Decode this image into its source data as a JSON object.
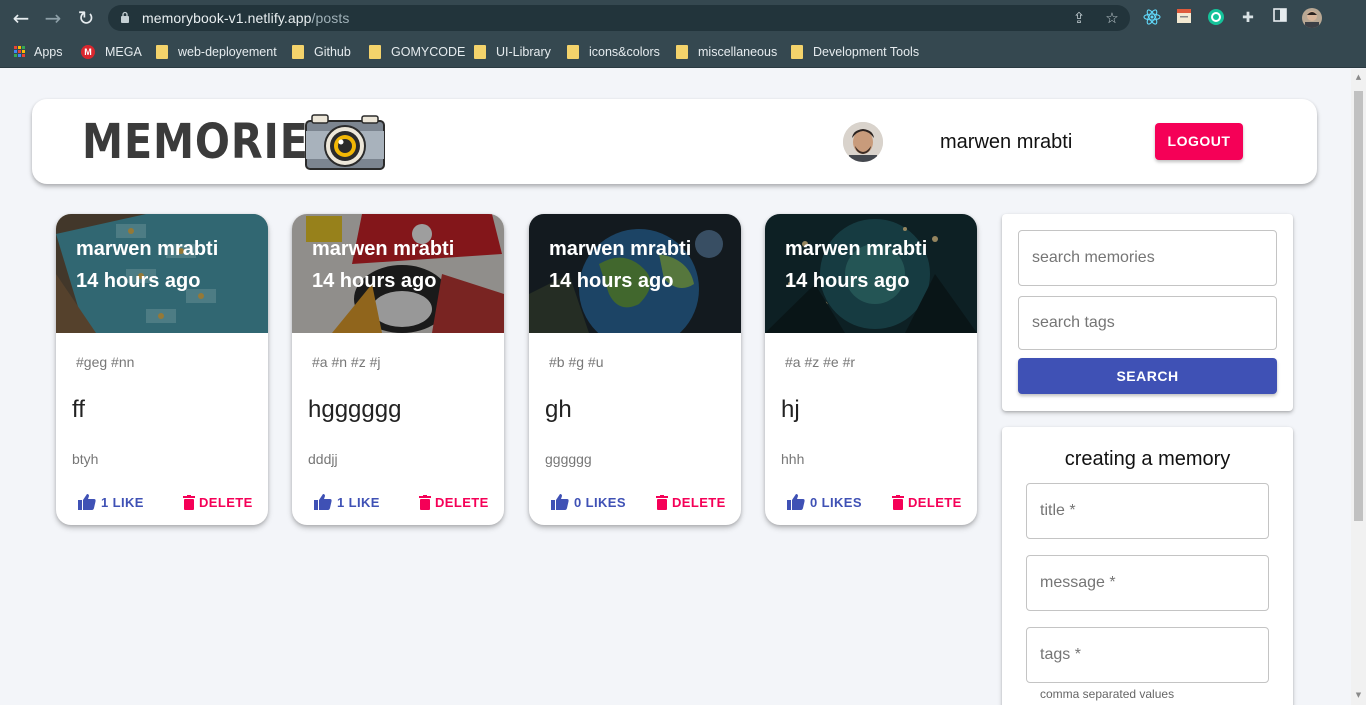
{
  "browser": {
    "url_domain": "memorybook-v1.netlify.app",
    "url_path": "/posts",
    "bookmarks": [
      "Apps",
      "MEGA",
      "web-deployement",
      "Github",
      "GOMYCODE",
      "UI-Library",
      "icons&colors",
      "miscellaneous",
      "Development Tools"
    ]
  },
  "header": {
    "brand": "MEMORIES",
    "username": "marwen mrabti",
    "logout_label": "LOGOUT"
  },
  "posts": [
    {
      "author": "marwen mrabti",
      "time": "14 hours ago",
      "tags": "#geg #nn",
      "title": "ff",
      "message": "btyh",
      "likes": "1 LIKE",
      "delete_label": "DELETE"
    },
    {
      "author": "marwen mrabti",
      "time": "14 hours ago",
      "tags": "#a #n #z #j",
      "title": "hgggggg",
      "message": "dddjj",
      "likes": "1 LIKE",
      "delete_label": "DELETE"
    },
    {
      "author": "marwen mrabti",
      "time": "14 hours ago",
      "tags": "#b #g #u",
      "title": "gh",
      "message": "gggggg",
      "likes": "0 LIKES",
      "delete_label": "DELETE"
    },
    {
      "author": "marwen mrabti",
      "time": "14 hours ago",
      "tags": "#a #z #e #r",
      "title": "hj",
      "message": "hhh",
      "likes": "0 LIKES",
      "delete_label": "DELETE"
    }
  ],
  "search": {
    "memories_placeholder": "search memories",
    "tags_placeholder": "search tags",
    "button_label": "SEARCH"
  },
  "form": {
    "title": "creating a memory",
    "title_placeholder": "title *",
    "message_placeholder": "message *",
    "tags_placeholder": "tags *",
    "tags_helper": "comma separated values"
  },
  "colors": {
    "primary": "#3f51b5",
    "secondary": "#f50057",
    "chrome": "#354850"
  }
}
